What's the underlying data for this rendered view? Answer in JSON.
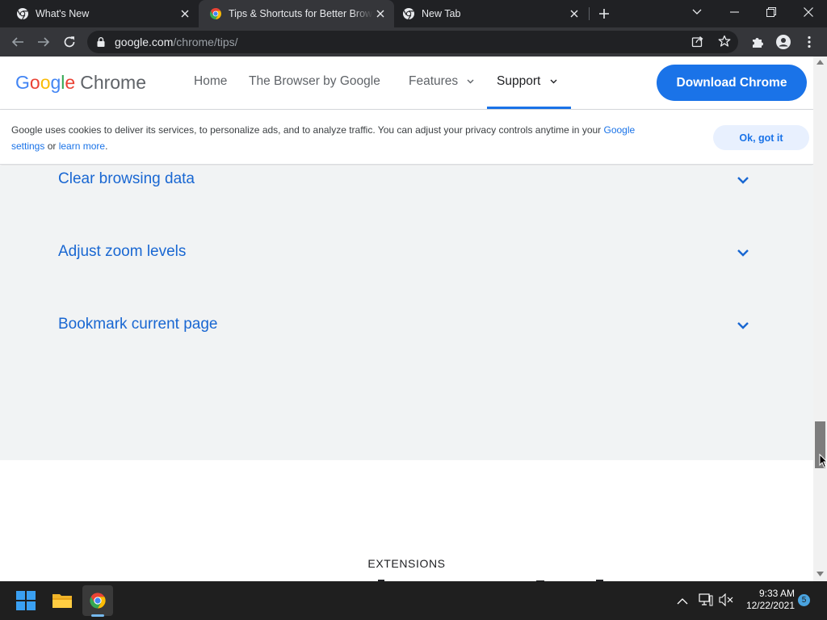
{
  "tabs": [
    {
      "title": "What's New",
      "icon": "chrome-app-icon",
      "active": false
    },
    {
      "title": "Tips & Shortcuts for Better Brows",
      "icon": "chrome-color-icon",
      "active": true
    },
    {
      "title": "New Tab",
      "icon": "chrome-app-icon",
      "active": false
    }
  ],
  "address_bar": {
    "host": "google.com",
    "path": "/chrome/tips/"
  },
  "site_header": {
    "logo_google_letters": [
      "G",
      "o",
      "o",
      "g",
      "l",
      "e"
    ],
    "logo_product": "Chrome",
    "nav": [
      {
        "label": "Home",
        "has_dropdown": false,
        "active": false
      },
      {
        "label": "The Browser by Google",
        "has_dropdown": false,
        "active": false
      },
      {
        "label": "Features",
        "has_dropdown": true,
        "active": false
      },
      {
        "label": "Support",
        "has_dropdown": true,
        "active": true
      }
    ],
    "cta_label": "Download Chrome"
  },
  "cookie_banner": {
    "text_before": "Google uses cookies to deliver its services, to personalize ads, and to analyze traffic. You can adjust your privacy controls anytime in your ",
    "link1": "Google settings",
    "text_middle": " or ",
    "link2": "learn more",
    "text_after": ".",
    "ok_label": "Ok, got it"
  },
  "faq_items": [
    {
      "question": "Clear browsing data"
    },
    {
      "question": "Adjust zoom levels"
    },
    {
      "question": "Bookmark current page"
    }
  ],
  "section_label": "EXTENSIONS",
  "taskbar": {
    "time": "9:33 AM",
    "date": "12/22/2021",
    "notification_count": "5"
  },
  "colors": {
    "link_blue": "#1a73e8",
    "faq_blue": "#1967d2",
    "section_grey": "#f1f3f4",
    "browser_frame": "#202124",
    "toolbar": "#35363a"
  }
}
